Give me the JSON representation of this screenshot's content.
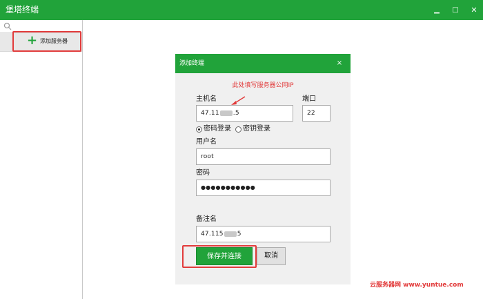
{
  "window": {
    "title": "堡塔终端",
    "minimize_glyph": "▁",
    "maximize_glyph": "□",
    "close_glyph": "✕"
  },
  "sidebar": {
    "add_server_label": "添加服务器",
    "add_icon": "plus-icon",
    "search_icon": "search-icon"
  },
  "dialog": {
    "title": "添加终端",
    "close_glyph": "×",
    "hint": "此处填写服务器公网IP",
    "hostname_label": "主机名",
    "hostname_value_prefix": "47.11",
    "hostname_value_suffix": ".5",
    "port_label": "端口",
    "port_value": "22",
    "auth_password_label": "密码登录",
    "auth_key_label": "密钥登录",
    "auth_selected": "密码登录",
    "username_label": "用户名",
    "username_value": "root",
    "password_label": "密码",
    "password_value": "●●●●●●●●●●●",
    "remark_label": "备注名",
    "remark_value_prefix": "47.115",
    "remark_value_suffix": "5",
    "save_button": "保存并连接",
    "cancel_button": "取消"
  },
  "watermark": "云服务器网 www.yuntue.com",
  "colors": {
    "brand_green": "#21a33a",
    "highlight_red": "#e23b3b"
  }
}
